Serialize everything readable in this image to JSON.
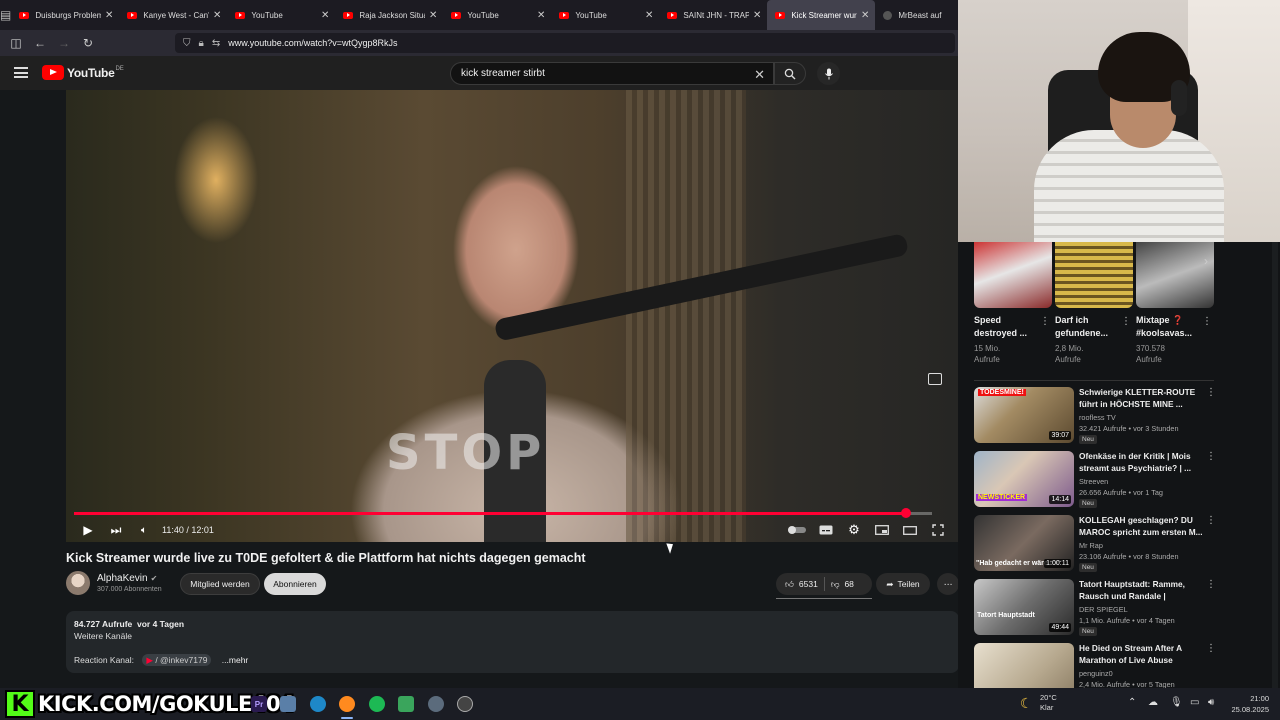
{
  "browser": {
    "tabs": [
      {
        "label": "Duisburgs Problem",
        "favicon": "youtube-favicon"
      },
      {
        "label": "Kanye West - Can't",
        "favicon": "youtube-favicon"
      },
      {
        "label": "YouTube",
        "favicon": "youtube-favicon"
      },
      {
        "label": "Raja Jackson Situati",
        "favicon": "youtube-favicon"
      },
      {
        "label": "YouTube",
        "favicon": "youtube-favicon"
      },
      {
        "label": "YouTube",
        "favicon": "youtube-favicon"
      },
      {
        "label": "SAINt JHN - TRAP (",
        "favicon": "youtube-favicon"
      },
      {
        "label": "Kick Streamer wurde",
        "favicon": "youtube-favicon",
        "active": true
      },
      {
        "label": "MrBeast auf",
        "favicon": "generic-favicon"
      }
    ],
    "url": "www.youtube.com/watch?v=wtQygp8RkJs"
  },
  "youtube": {
    "logo_text": "YouTube",
    "country_code": "DE",
    "search_value": "kick streamer stirbt",
    "player": {
      "time": "11:40 / 12:01",
      "progress_fraction": 0.97
    },
    "video": {
      "title": "Kick Streamer wurde live zu T0DE gefoltert & die Plattform hat nichts dagegen gemacht",
      "channel": "AlphaKevin",
      "subscribers": "307.000 Abonnenten",
      "join_label": "Mitglied werden",
      "subscribe_label": "Abonnieren",
      "likes": "6531",
      "dislikes": "68",
      "share_label": "Teilen",
      "shirt_text": "STOP"
    },
    "description": {
      "views": "84.727 Aufrufe",
      "age": "vor 4 Tagen",
      "more_channels": "Weitere Kanäle",
      "reaction_label": "Reaction Kanal:",
      "reaction_tag": "/ @inkev7179",
      "more_label": "...mehr"
    },
    "shorts": [
      {
        "title": "Speed destroyed ...",
        "views": "15 Mio.",
        "views_unit": "Aufrufe"
      },
      {
        "title": "Darf ich gefundene...",
        "views": "2,8 Mio.",
        "views_unit": "Aufrufe"
      },
      {
        "title": "Mixtape ❓ #koolsavas...",
        "views": "370.578",
        "views_unit": "Aufrufe"
      }
    ],
    "recommendations": [
      {
        "title": "Schwierige KLETTER-ROUTE führt in HÖCHSTE MINE ...",
        "channel": "roofless TV",
        "meta": "32.421 Aufrufe • vor 3 Stunden",
        "badge": "Neu",
        "duration": "39:07",
        "thumb_text": "TODESMINE!"
      },
      {
        "title": "Ofenkäse in der Kritik | Mois streamt aus Psychiatrie? | ...",
        "channel": "Streeven",
        "meta": "26.656 Aufrufe • vor 1 Tag",
        "badge": "Neu",
        "duration": "14:14",
        "thumb_text": "NEWSTICKER"
      },
      {
        "title": "KOLLEGAH geschlagen? DU MAROC spricht zum ersten M...",
        "channel": "Mr Rap",
        "meta": "23.106 Aufrufe • vor 8 Stunden",
        "badge": "Neu",
        "duration": "1:00:11",
        "thumb_text": "\"Hab gedacht er wäre tot\""
      },
      {
        "title": "Tatort Hauptstadt: Ramme, Rausch und Randale | SPIEGE...",
        "channel": "DER SPIEGEL",
        "meta": "1,1 Mio. Aufrufe • vor 4 Tagen",
        "badge": "Neu",
        "duration": "49:44",
        "thumb_text": "Tatort Hauptstadt"
      },
      {
        "title": "He Died on Stream After A Marathon of Live Abuse",
        "channel": "penguinz0",
        "meta": "2,4 Mio. Aufrufe • vor 5 Tagen",
        "badge": "",
        "duration": "",
        "thumb_text": ""
      }
    ]
  },
  "overlay": {
    "kick_letter": "K",
    "kick_url": "KICK.COM/GOKULE404"
  },
  "taskbar": {
    "weather_temp": "20°C",
    "weather_desc": "Klar",
    "time": "21:00",
    "date": "25.08.2025",
    "apps": [
      "premiere-icon",
      "file-explorer-icon",
      "edge-icon",
      "firefox-icon",
      "spotify-icon",
      "notepad-icon",
      "settings-icon",
      "obs-icon"
    ]
  },
  "colors": {
    "accent_red": "#ff0033",
    "kick_green": "#53fc18"
  }
}
